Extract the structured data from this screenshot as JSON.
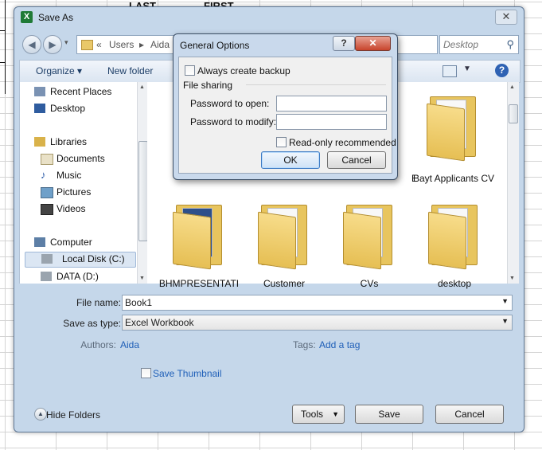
{
  "background": {
    "headers": [
      "LAST",
      "FIRST"
    ]
  },
  "window": {
    "title": "Save As",
    "app_icon": "excel-icon",
    "close_glyph": "✕"
  },
  "address": {
    "crumbs": [
      "«",
      "Users",
      "▸",
      "Aida",
      "▸"
    ],
    "search_placeholder": "Desktop"
  },
  "toolbar": {
    "organize": "Organize ▾",
    "new_folder": "New folder",
    "help": "?"
  },
  "nav": {
    "items": [
      {
        "label": "Recent Places",
        "icon": "recent-places-icon"
      },
      {
        "label": "Desktop",
        "icon": "desktop-icon"
      },
      {
        "label": "Libraries",
        "icon": "libraries-icon"
      },
      {
        "label": "Documents",
        "icon": "documents-icon"
      },
      {
        "label": "Music",
        "icon": "music-icon"
      },
      {
        "label": "Pictures",
        "icon": "pictures-icon"
      },
      {
        "label": "Videos",
        "icon": "videos-icon"
      },
      {
        "label": "Computer",
        "icon": "computer-icon"
      },
      {
        "label": "Local Disk (C:)",
        "icon": "drive-icon"
      },
      {
        "label": "DATA (D:)",
        "icon": "drive-icon"
      }
    ]
  },
  "files": {
    "row1_right": [
      "E",
      "Bayt Applicants CV"
    ],
    "folders": [
      "BHMPRESENTATI",
      "Customer",
      "CVs",
      "desktop"
    ]
  },
  "form": {
    "file_name_label": "File name:",
    "file_name_value": "Book1",
    "save_type_label": "Save as type:",
    "save_type_value": "Excel Workbook",
    "authors_label": "Authors:",
    "authors_value": "Aida",
    "tags_label": "Tags:",
    "tags_value": "Add a tag",
    "thumbnail_label": "Save Thumbnail",
    "hide_folders": "Hide Folders",
    "tools": "Tools",
    "save": "Save",
    "cancel": "Cancel"
  },
  "dialog": {
    "title": "General Options",
    "help": "?",
    "close": "✕",
    "always_backup": "Always create backup",
    "file_sharing": "File sharing",
    "password_open": "Password to open:",
    "password_modify": "Password to modify:",
    "readonly": "Read-only recommended",
    "ok": "OK",
    "cancel": "Cancel"
  }
}
